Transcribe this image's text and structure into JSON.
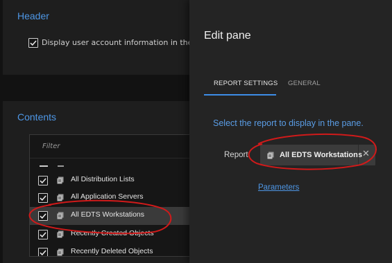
{
  "header_section": {
    "title": "Header",
    "checkbox_label": "Display user account information in the head",
    "checked": true
  },
  "contents_section": {
    "title": "Contents",
    "filter_placeholder": "Filter",
    "items": [
      {
        "label": "All Distribution Lists",
        "checked": true,
        "selected": false
      },
      {
        "label": "All Application Servers",
        "checked": true,
        "selected": false
      },
      {
        "label": "All EDTS Workstations",
        "checked": true,
        "selected": true
      },
      {
        "label": "Recently Created Objects",
        "checked": true,
        "selected": false
      },
      {
        "label": "Recently Deleted Objects",
        "checked": true,
        "selected": false
      }
    ]
  },
  "edit_pane": {
    "title": "Edit pane",
    "tabs": [
      {
        "label": "REPORT SETTINGS",
        "active": true
      },
      {
        "label": "GENERAL",
        "active": false
      }
    ],
    "hint": "Select the report to display in the pane.",
    "report_label": "Report",
    "selected_report": "All EDTS Workstations",
    "remove_glyph": "✕",
    "parameters_link": "Parameters"
  },
  "colors": {
    "accent": "#4e97e6",
    "annotation": "#d11a1a",
    "background": "#121212"
  },
  "icons": {
    "report": "report-scroll-icon",
    "checkbox": "checkmark-icon",
    "remove": "close-icon"
  }
}
